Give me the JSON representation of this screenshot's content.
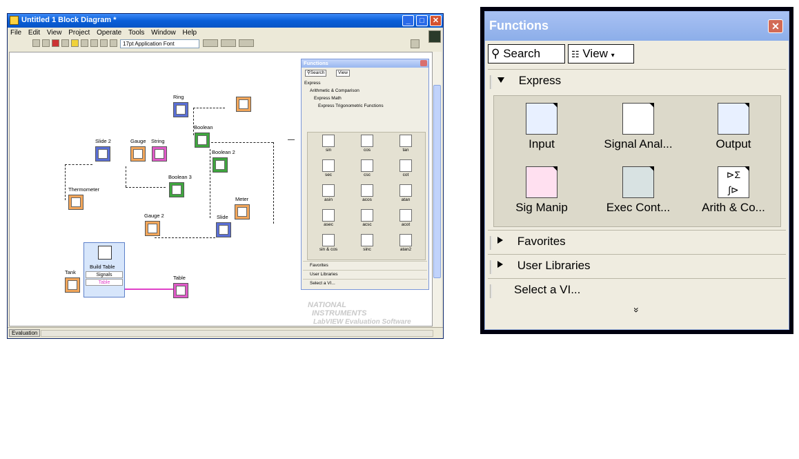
{
  "left_window": {
    "title": "Untitled 1 Block Diagram *",
    "menu": [
      "File",
      "Edit",
      "View",
      "Project",
      "Operate",
      "Tools",
      "Window",
      "Help"
    ],
    "font_selector": "17pt Application Font",
    "status_tab": "Evaluation",
    "nodes": {
      "ring": "Ring",
      "slide2": "Slide 2",
      "gauge": "Gauge",
      "string": "String",
      "boolean": "Boolean",
      "boolean2": "Boolean 2",
      "boolean3": "Boolean 3",
      "thermometer": "Thermometer",
      "meter": "Meter",
      "gauge2": "Gauge 2",
      "slide": "Slide",
      "tank": "Tank",
      "table": "Table",
      "build_table": "Build Table",
      "signals": "Signals",
      "table_port": "Table"
    },
    "mini_palette": {
      "title": "Functions",
      "search": "Search",
      "view": "View",
      "tree": [
        "Express",
        "Arithmetic & Comparison",
        "Express Math",
        "Express Trigonometric Functions"
      ],
      "cells": [
        "sin",
        "cos",
        "tan",
        "sec",
        "csc",
        "cot",
        "asin",
        "acos",
        "atan",
        "asec",
        "acsc",
        "acot",
        "sin & cos",
        "sinc",
        "atan2"
      ],
      "rows": [
        "Favorites",
        "User Libraries",
        "Select a VI..."
      ]
    },
    "watermark": {
      "line1": "NATIONAL",
      "line2": "INSTRUMENTS",
      "line3": "LabVIEW Evaluation Software"
    }
  },
  "right_window": {
    "title": "Functions",
    "search_label": "Search",
    "view_label": "View",
    "express_label": "Express",
    "items": [
      "Input",
      "Signal Anal...",
      "Output",
      "Sig Manip",
      "Exec Cont...",
      "Arith & Co..."
    ],
    "favorites_label": "Favorites",
    "user_libraries_label": "User Libraries",
    "select_vi_label": "Select a VI...",
    "more_glyph": "»"
  },
  "colors": {
    "xp_blue": "#0a5fd8",
    "palette_title": "#8caee9",
    "node_blue": "#5a6fd6",
    "node_pink": "#e05ac8",
    "node_green": "#3fa63f",
    "node_orange": "#f2a65a",
    "wire_pink": "#e040c8"
  }
}
